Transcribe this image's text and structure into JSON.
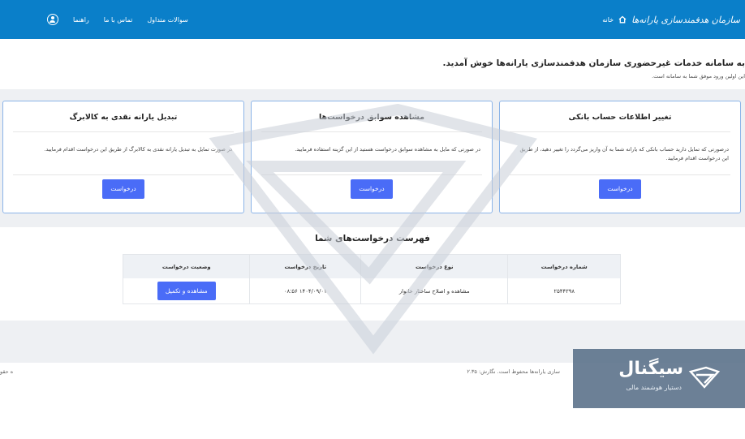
{
  "header": {
    "brand": "سازمان هدفمندسازی یارانه‌ها",
    "home": "خانه",
    "nav": [
      "سوالات متداول",
      "تماس با ما",
      "راهنما"
    ]
  },
  "welcome": {
    "title": "به سامانه خدمات غیرحضوری سازمان هدفمندسازی یارانه‌ها خوش آمدید.",
    "subtitle": "این اولین ورود موفق شما به سامانه است."
  },
  "cards": [
    {
      "title": "تغییر اطلاعات حساب بانکی",
      "text": "درصورتی که تمایل دارید حساب بانکی که یارانه شما به آن واریز می‌گردد را تغییر دهید، از طریق این درخواست اقدام فرمایید.",
      "button": "درخواست"
    },
    {
      "title": "مشاهده سوابق درخواست‌ها",
      "text": "در صورتی که مایل به مشاهده سوابق درخواست هستید از این گزینه استفاده فرمایید.",
      "button": "درخواست"
    },
    {
      "title": "تبدیل یارانه نقدی به کالابرگ",
      "text": "در صورت تمایل به تبدیل یارانه نقدی به کالابرگ از طریق این درخواست اقدام فرمایید.",
      "button": "درخواست"
    }
  ],
  "requests": {
    "title": "فهرست درخواست‌های شما",
    "columns": [
      "شماره درخواست",
      "نوع درخواست",
      "تاریخ درخواست",
      "وضعیت درخواست"
    ],
    "rows": [
      {
        "number": "۲۵۴۴۳۹۸",
        "type": "مشاهده و اصلاح ساختار خانوار",
        "date": "۱۴۰۴/۰۹/۰۱ ۰۸:۵۶",
        "action": "مشاهده و تکمیل"
      }
    ]
  },
  "footer": {
    "text": "سازی یارانه‌ها محفوظ است. نگارش: ۲.۳۵",
    "left": "ه حقو"
  },
  "signal": {
    "name": "سیگنال",
    "subtitle": "دستیار هوشمند مالی"
  }
}
